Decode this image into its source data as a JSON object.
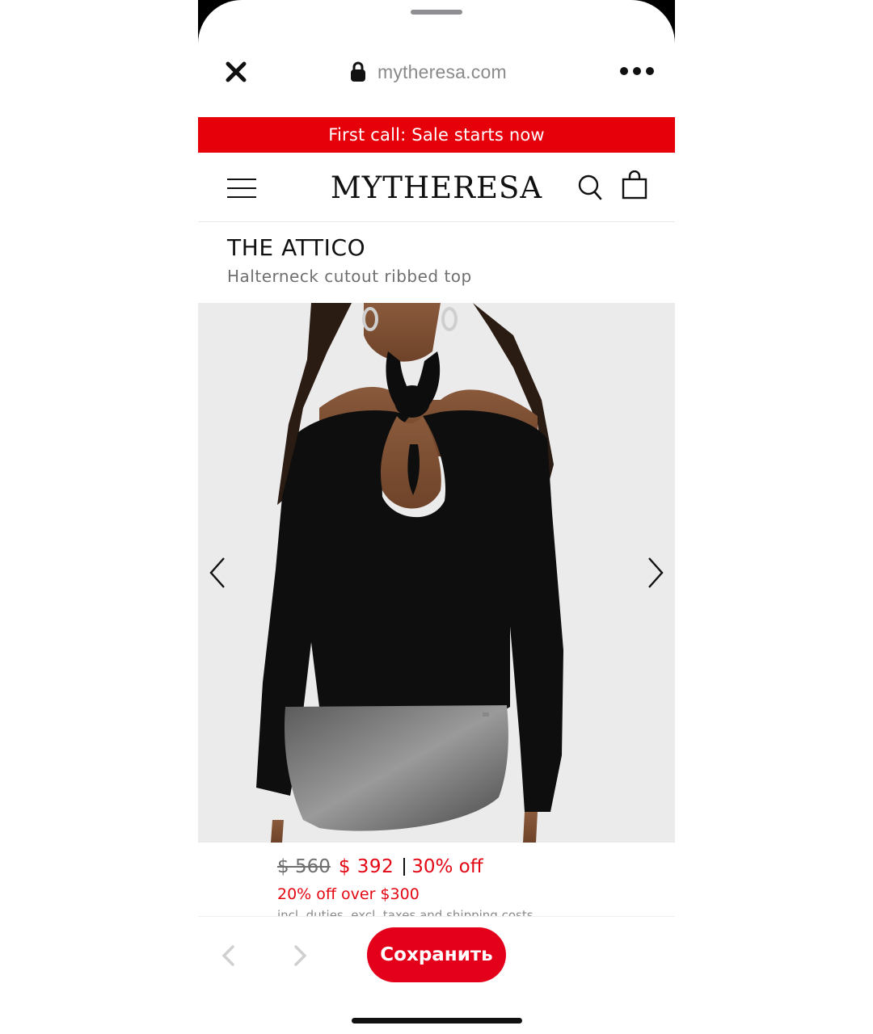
{
  "theme": {
    "accent_red": "#e40613",
    "banner_red": "#e60009",
    "save_button_red": "#e4001b",
    "disabled_gray": "#d0d0d0"
  },
  "browser": {
    "url": "mytheresa.com",
    "close_icon": "close-icon",
    "lock_icon": "lock-icon",
    "more_icon": "more-icon"
  },
  "promo_banner": {
    "text": "First call: Sale starts now"
  },
  "header": {
    "logo": "MYTHERESA",
    "menu_icon": "menu-icon",
    "search_icon": "search-icon",
    "bag_icon": "shopping-bag-icon"
  },
  "product": {
    "brand": "THE ATTICO",
    "name": "Halterneck cutout ribbed top",
    "price_old": "$ 560",
    "price_new": "$ 392",
    "discount": "30% off",
    "promo": "20% off over $300",
    "duties": "incl. duties, excl. taxes and shipping costs"
  },
  "gallery": {
    "prev_icon": "chevron-left-icon",
    "next_icon": "chevron-right-icon"
  },
  "toolbar": {
    "save_label": "Сохранить",
    "back_icon": "chevron-left-icon",
    "forward_icon": "chevron-right-icon"
  }
}
